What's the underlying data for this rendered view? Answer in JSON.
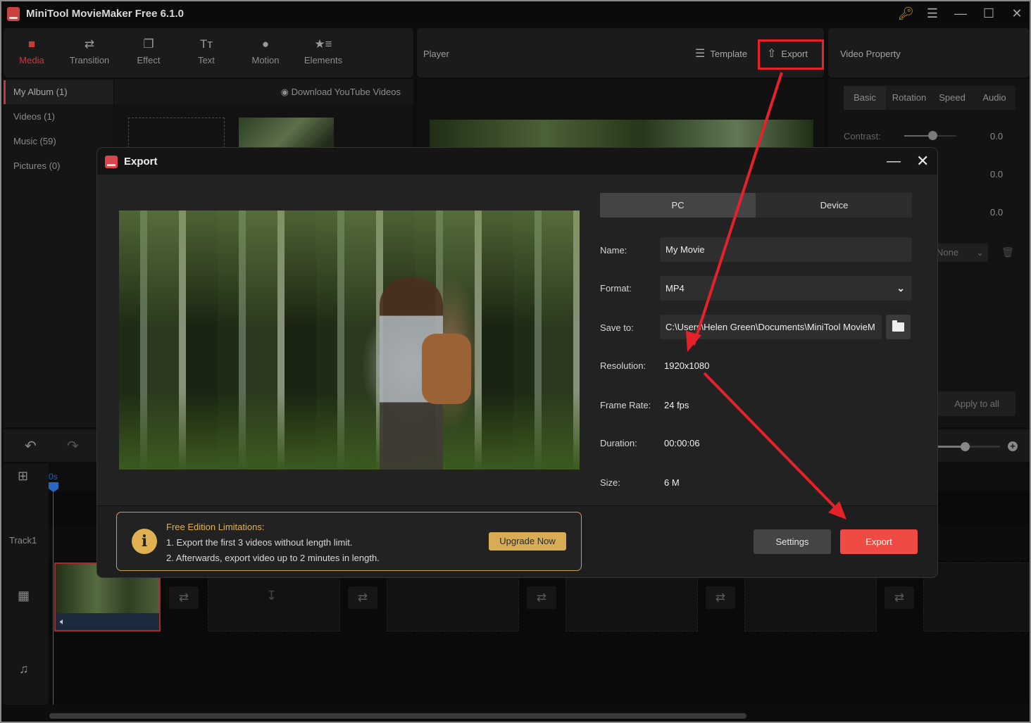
{
  "app": {
    "title": "MiniTool MovieMaker Free 6.1.0",
    "window_controls": [
      "key-icon",
      "menu-icon",
      "minimize-icon",
      "maximize-icon",
      "close-icon"
    ]
  },
  "toolbar": {
    "tools": [
      {
        "label": "Media",
        "icon": "folder-icon",
        "active": true
      },
      {
        "label": "Transition",
        "icon": "swap-arrows-icon",
        "active": false
      },
      {
        "label": "Effect",
        "icon": "layers-icon",
        "active": false
      },
      {
        "label": "Text",
        "icon": "text-icon",
        "active": false
      },
      {
        "label": "Motion",
        "icon": "motion-icon",
        "active": false
      },
      {
        "label": "Elements",
        "icon": "star-list-icon",
        "active": false
      }
    ]
  },
  "player": {
    "label": "Player",
    "template_label": "Template",
    "export_label": "Export"
  },
  "video_property": {
    "label": "Video Property",
    "tabs": [
      "Basic",
      "Rotation",
      "Speed",
      "Audio"
    ],
    "active_tab": "Basic",
    "rows": [
      {
        "label": "Contrast:",
        "value": "0.0"
      },
      {
        "label": "",
        "value": "0.0"
      },
      {
        "label": "",
        "value": "0.0"
      }
    ],
    "lut_select": "None",
    "apply_all_label": "Apply to all"
  },
  "library": {
    "items": [
      {
        "label": "My Album (1)",
        "active": true
      },
      {
        "label": "Videos (1)",
        "active": false
      },
      {
        "label": "Music (59)",
        "active": false
      },
      {
        "label": "Pictures (0)",
        "active": false
      }
    ],
    "download_label": "Download YouTube Videos"
  },
  "timeline": {
    "ruler_start": "0s",
    "track_label": "Track1"
  },
  "export_dialog": {
    "title": "Export",
    "dest_tabs": [
      "PC",
      "Device"
    ],
    "active_dest": "PC",
    "fields": {
      "name_label": "Name:",
      "name_value": "My Movie",
      "format_label": "Format:",
      "format_value": "MP4",
      "save_label": "Save to:",
      "save_value": "C:\\Users\\Helen Green\\Documents\\MiniTool MovieM",
      "resolution_label": "Resolution:",
      "resolution_value": "1920x1080",
      "framerate_label": "Frame Rate:",
      "framerate_value": "24 fps",
      "duration_label": "Duration:",
      "duration_value": "00:00:06",
      "size_label": "Size:",
      "size_value": "6 M"
    },
    "limits": {
      "title": "Free Edition Limitations:",
      "line1": "1. Export the first 3 videos without length limit.",
      "line2": "2. Afterwards, export video up to 2 minutes in length.",
      "upgrade_label": "Upgrade Now"
    },
    "settings_label": "Settings",
    "export_label": "Export"
  },
  "colors": {
    "accent": "#c73a3a",
    "export_button": "#f04a45",
    "annotation": "#e5212a",
    "limits_gold": "#e0b052"
  }
}
